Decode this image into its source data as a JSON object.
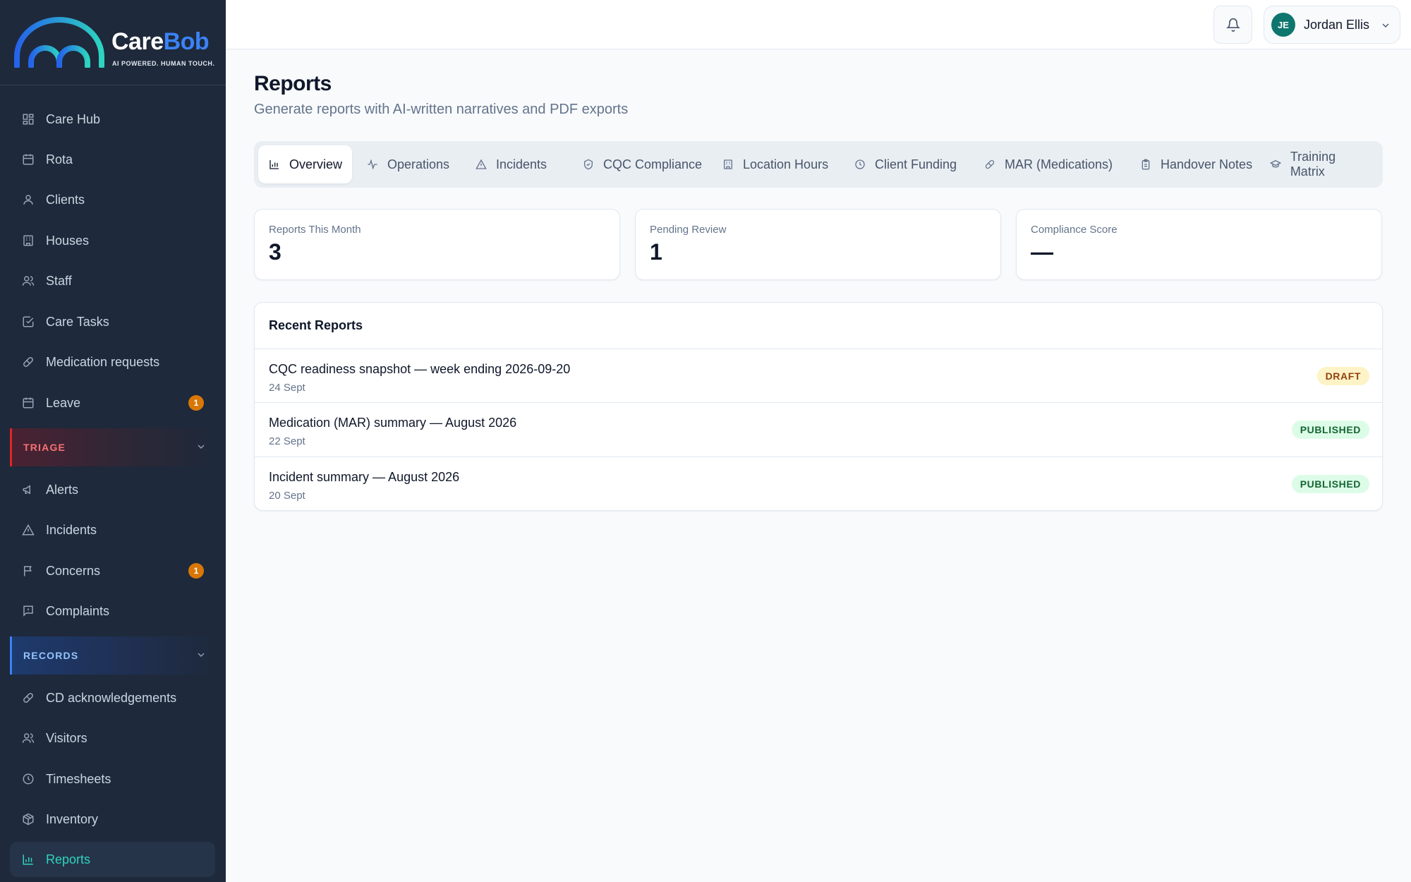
{
  "brand": {
    "name_part1": "Care",
    "name_part2": "Bob",
    "tagline": "AI POWERED. HUMAN TOUCH."
  },
  "sidebar": {
    "items": [
      {
        "label": "Care Hub",
        "icon": "layout-grid-icon"
      },
      {
        "label": "Rota",
        "icon": "calendar-icon"
      },
      {
        "label": "Clients",
        "icon": "user-icon"
      },
      {
        "label": "Houses",
        "icon": "building-icon"
      },
      {
        "label": "Staff",
        "icon": "users-icon"
      },
      {
        "label": "Care Tasks",
        "icon": "check-square-icon"
      },
      {
        "label": "Medication requests",
        "icon": "pill-icon"
      },
      {
        "label": "Leave",
        "icon": "calendar-icon",
        "badge": "1"
      }
    ],
    "triage": {
      "title": "TRIAGE",
      "items": [
        {
          "label": "Alerts",
          "icon": "megaphone-icon"
        },
        {
          "label": "Incidents",
          "icon": "warning-triangle-icon"
        },
        {
          "label": "Concerns",
          "icon": "flag-icon",
          "badge": "1"
        },
        {
          "label": "Complaints",
          "icon": "message-alert-icon"
        }
      ]
    },
    "records": {
      "title": "RECORDS",
      "items": [
        {
          "label": "CD acknowledgements",
          "icon": "pill-icon"
        },
        {
          "label": "Visitors",
          "icon": "users-icon"
        },
        {
          "label": "Timesheets",
          "icon": "clock-icon"
        },
        {
          "label": "Inventory",
          "icon": "box-icon"
        },
        {
          "label": "Reports",
          "icon": "bar-chart-icon",
          "active": true
        }
      ]
    }
  },
  "header": {
    "user": {
      "initials": "JE",
      "name": "Jordan Ellis"
    }
  },
  "page": {
    "title": "Reports",
    "subtitle": "Generate reports with AI-written narratives and PDF exports"
  },
  "tabs": [
    {
      "label": "Overview",
      "icon": "bar-chart-icon",
      "active": true
    },
    {
      "label": "Operations",
      "icon": "activity-icon"
    },
    {
      "label": "Incidents",
      "icon": "warning-triangle-icon"
    },
    {
      "label": "CQC Compliance",
      "icon": "shield-check-icon"
    },
    {
      "label": "Location Hours",
      "icon": "building-icon"
    },
    {
      "label": "Client Funding",
      "icon": "clock-icon"
    },
    {
      "label": "MAR (Medications)",
      "icon": "pill-icon"
    },
    {
      "label": "Handover Notes",
      "icon": "clipboard-icon"
    },
    {
      "label": "Training Matrix",
      "icon": "graduation-cap-icon"
    }
  ],
  "stats": [
    {
      "label": "Reports This Month",
      "value": "3"
    },
    {
      "label": "Pending Review",
      "value": "1"
    },
    {
      "label": "Compliance Score",
      "value": "—"
    }
  ],
  "recent": {
    "title": "Recent Reports",
    "rows": [
      {
        "title": "CQC readiness snapshot — week ending 2026-09-20",
        "date": "24 Sept",
        "status": "DRAFT"
      },
      {
        "title": "Medication (MAR) summary — August 2026",
        "date": "22 Sept",
        "status": "PUBLISHED"
      },
      {
        "title": "Incident summary — August 2026",
        "date": "20 Sept",
        "status": "PUBLISHED"
      }
    ]
  },
  "colors": {
    "sidebar_bg": "#1e293b",
    "accent_teal": "#2dd4bf",
    "brand_blue": "#3b82f6",
    "badge_orange": "#d97706"
  }
}
